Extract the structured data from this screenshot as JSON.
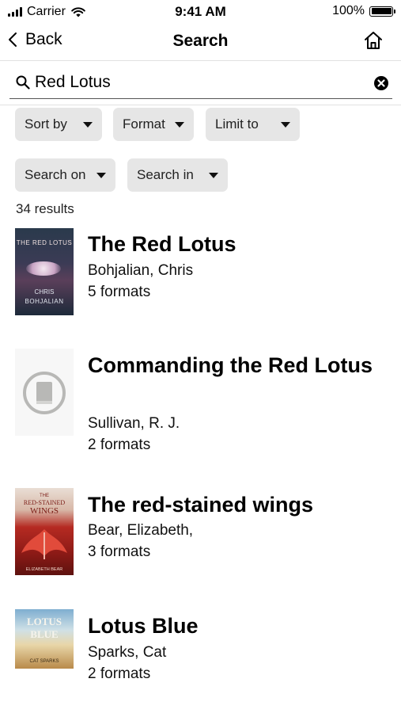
{
  "status_bar": {
    "carrier": "Carrier",
    "time": "9:41 AM",
    "battery": "100%"
  },
  "nav": {
    "back_label": "Back",
    "title": "Search"
  },
  "search": {
    "query": "Red Lotus"
  },
  "filters": {
    "sort_by": "Sort by",
    "format": "Format",
    "limit_to": "Limit to",
    "search_on": "Search on",
    "search_in": "Search in"
  },
  "results_count": "34 results",
  "results": [
    {
      "title": "The Red Lotus",
      "author": "Bohjalian, Chris",
      "formats": "5 formats",
      "cover_text": [
        "THE RED LOTUS",
        "CHRIS",
        "BOHJALIAN"
      ]
    },
    {
      "title": "Commanding the Red Lotus",
      "author": "Sullivan, R. J.",
      "formats": "2 formats",
      "cover": "placeholder-book-icon"
    },
    {
      "title": "The red-stained wings",
      "author": "Bear, Elizabeth,",
      "formats": "3 formats",
      "cover_text": [
        "THE",
        "RED-STAINED",
        "WINGS",
        "ELIZABETH BEAR"
      ]
    },
    {
      "title": "Lotus Blue",
      "author": "Sparks, Cat",
      "formats": "2 formats",
      "cover_text": [
        "LOTUS",
        "BLUE",
        "CAT SPARKS"
      ]
    }
  ],
  "colors": {
    "chip_bg": "#e6e6e6",
    "divider": "#e2e2e2",
    "text": "#000000"
  }
}
